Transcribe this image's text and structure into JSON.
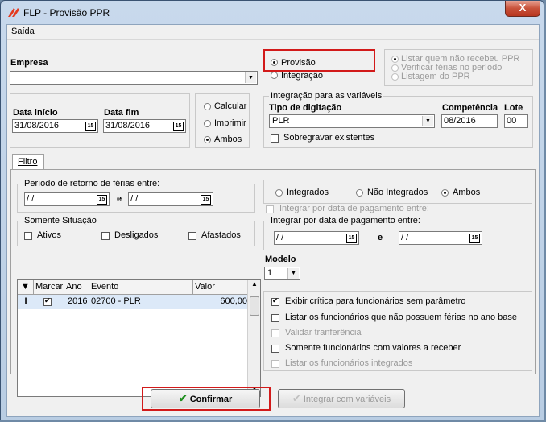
{
  "window": {
    "title": "FLP - Provisão PPR",
    "close_label": "X"
  },
  "menu": {
    "saida": "Saída"
  },
  "empresa": {
    "label": "Empresa",
    "value": ""
  },
  "tipo": {
    "provisao": "Provisão",
    "integracao": "Integração",
    "selected": "Provisão"
  },
  "options_right": [
    "Listar quem não recebeu PPR",
    "Verificar férias no período",
    "Listagem do PPR"
  ],
  "datas": {
    "inicio_label": "Data início",
    "inicio_value": "31/08/2016",
    "fim_label": "Data fim",
    "fim_value": "31/08/2016",
    "cal_icon": "15"
  },
  "acao": {
    "calcular": "Calcular",
    "imprimir": "Imprimir",
    "ambos": "Ambos",
    "selected": "Ambos"
  },
  "integracao_var": {
    "group_title": "Integração para as variáveis",
    "tipo_label": "Tipo de digitação",
    "tipo_value": "PLR",
    "competencia_label": "Competência",
    "competencia_value": "08/2016",
    "lote_label": "Lote",
    "lote_value": "00",
    "sobregravar": "Sobregravar existentes"
  },
  "tab": {
    "label": "Filtro"
  },
  "periodo": {
    "title": "Período de retorno de férias entre:",
    "de": "/ /",
    "e": "e",
    "ate": "/ /"
  },
  "situacao": {
    "title": "Somente Situação",
    "ativos": "Ativos",
    "desligados": "Desligados",
    "afastados": "Afastados"
  },
  "integrados_filter": {
    "integrados": "Integrados",
    "nao_integrados": "Não Integrados",
    "ambos": "Ambos",
    "selected": "Ambos"
  },
  "pagamento": {
    "disabled_check": "Integrar por data de pagamento entre:",
    "group_title": "Integrar por data de pagamento entre:",
    "de": "/ /",
    "e": "e",
    "ate": "/ /"
  },
  "grid": {
    "columns": [
      "Marcar",
      "Ano",
      "Evento",
      "Valor"
    ],
    "rows": [
      {
        "indicator": "I",
        "marcar": true,
        "ano": "2016",
        "evento": "02700 - PLR",
        "valor": "600,00"
      }
    ]
  },
  "modelo": {
    "label": "Modelo",
    "value": "1"
  },
  "checks": [
    {
      "label": "Exibir crítica para funcionários sem parâmetro",
      "checked": true,
      "enabled": true
    },
    {
      "label": "Listar os funcionários que não possuem férias no ano base",
      "checked": false,
      "enabled": true
    },
    {
      "label": "Validar tranferência",
      "checked": false,
      "enabled": false
    },
    {
      "label": "Somente funcionários com valores a receber",
      "checked": false,
      "enabled": true
    },
    {
      "label": "Listar os funcionários integrados",
      "checked": false,
      "enabled": false
    }
  ],
  "buttons": {
    "confirmar": "Confirmar",
    "integrar": "Integrar com variáveis"
  },
  "colors": {
    "highlight": "#d21a1a",
    "row_selected": "#dce9f8"
  }
}
